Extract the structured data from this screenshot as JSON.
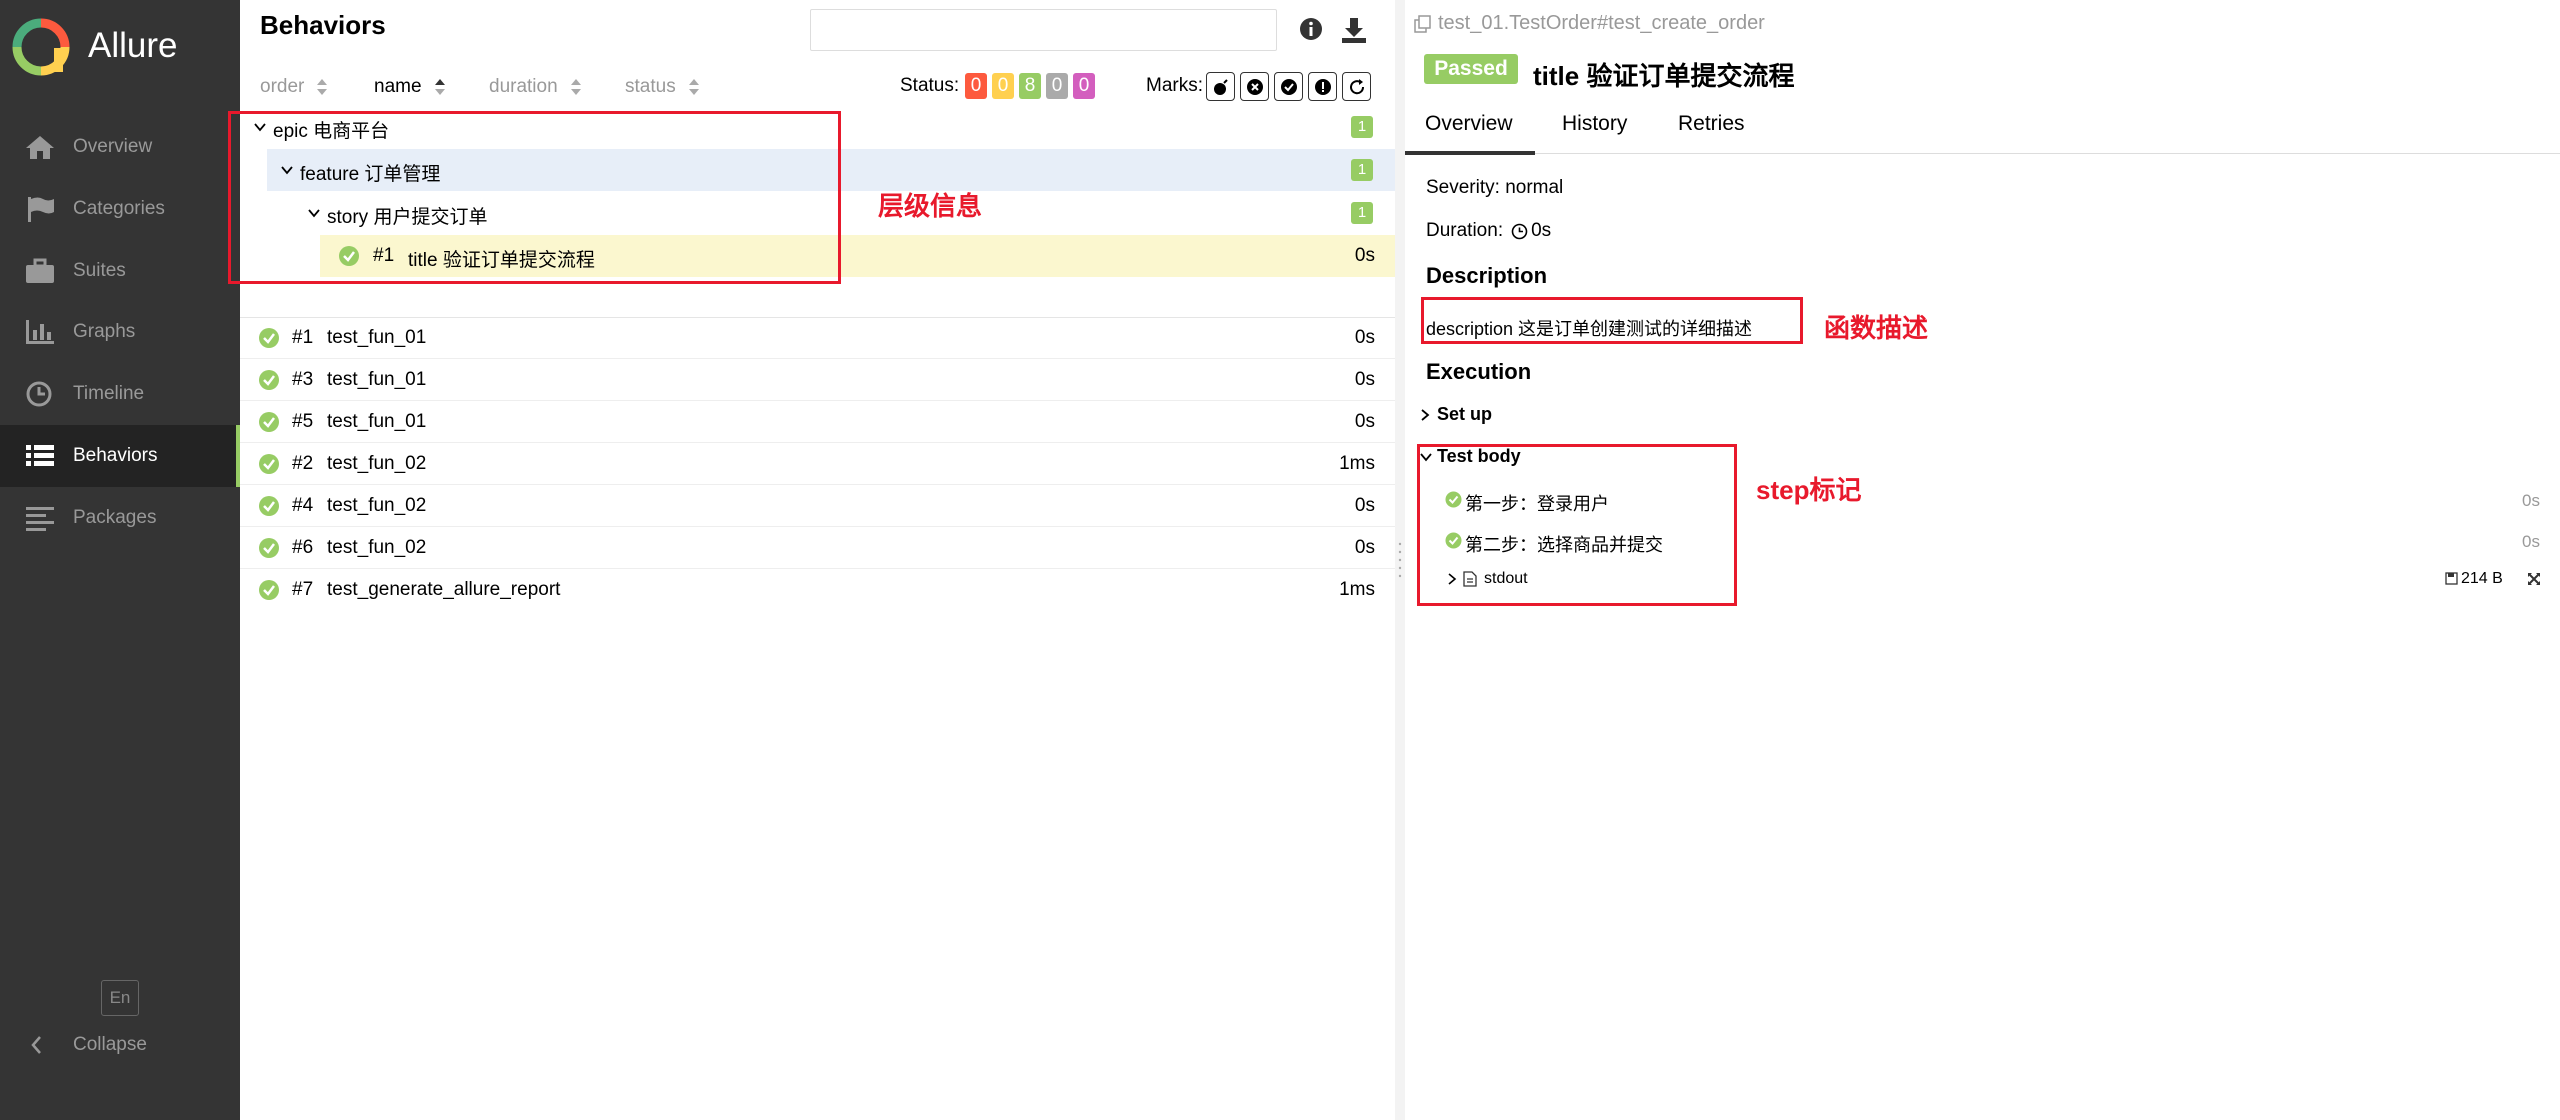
{
  "app": {
    "brand": "Allure",
    "lang": "En",
    "collapse_label": "Collapse"
  },
  "sidebar": {
    "items": [
      {
        "label": "Overview",
        "icon": "home-icon"
      },
      {
        "label": "Categories",
        "icon": "flag-icon"
      },
      {
        "label": "Suites",
        "icon": "briefcase-icon"
      },
      {
        "label": "Graphs",
        "icon": "bar-chart-icon"
      },
      {
        "label": "Timeline",
        "icon": "clock-icon"
      },
      {
        "label": "Behaviors",
        "icon": "list-icon",
        "active": true
      },
      {
        "label": "Packages",
        "icon": "align-left-icon"
      }
    ]
  },
  "behaviors": {
    "title": "Behaviors",
    "search_placeholder": "",
    "columns": [
      "order",
      "name",
      "duration",
      "status"
    ],
    "status_label": "Status:",
    "status_counts": [
      {
        "value": "0",
        "color": "#fd5a3e"
      },
      {
        "value": "0",
        "color": "#ffd050"
      },
      {
        "value": "8",
        "color": "#97cc64"
      },
      {
        "value": "0",
        "color": "#aaaaaa"
      },
      {
        "value": "0",
        "color": "#d35ebe"
      }
    ],
    "marks_label": "Marks:",
    "tree": {
      "epic": {
        "label": "epic 电商平台",
        "count": "1"
      },
      "feature": {
        "label": "feature 订单管理",
        "count": "1"
      },
      "story": {
        "label": "story 用户提交订单",
        "count": "1"
      },
      "test": {
        "num": "#1",
        "name": "title 验证订单提交流程",
        "duration": "0s"
      }
    },
    "flat_rows": [
      {
        "num": "#1",
        "name": "test_fun_01",
        "duration": "0s"
      },
      {
        "num": "#3",
        "name": "test_fun_01",
        "duration": "0s"
      },
      {
        "num": "#5",
        "name": "test_fun_01",
        "duration": "0s"
      },
      {
        "num": "#2",
        "name": "test_fun_02",
        "duration": "1ms"
      },
      {
        "num": "#4",
        "name": "test_fun_02",
        "duration": "0s"
      },
      {
        "num": "#6",
        "name": "test_fun_02",
        "duration": "0s"
      },
      {
        "num": "#7",
        "name": "test_generate_allure_report",
        "duration": "1ms"
      }
    ]
  },
  "detail": {
    "path": "test_01.TestOrder#test_create_order",
    "status": "Passed",
    "title": "title 验证订单提交流程",
    "tabs": [
      "Overview",
      "History",
      "Retries"
    ],
    "severity": "Severity: normal",
    "duration_label": "Duration:",
    "duration_value": "0s",
    "description_head": "Description",
    "description": "description 这是订单创建测试的详细描述",
    "execution_head": "Execution",
    "setup_label": "Set up",
    "test_body_label": "Test body",
    "steps": [
      {
        "label": "第一步：登录用户",
        "duration": "0s"
      },
      {
        "label": "第二步：选择商品并提交",
        "duration": "0s"
      }
    ],
    "attachment": {
      "label": "stdout",
      "size": "214 B"
    }
  },
  "annotations": {
    "hierarchy": "层级信息",
    "description": "函数描述",
    "steps": "step标记"
  },
  "colors": {
    "accent_green": "#97cc64",
    "annotation_red": "#e8192c",
    "sidebar_bg": "#343434"
  }
}
